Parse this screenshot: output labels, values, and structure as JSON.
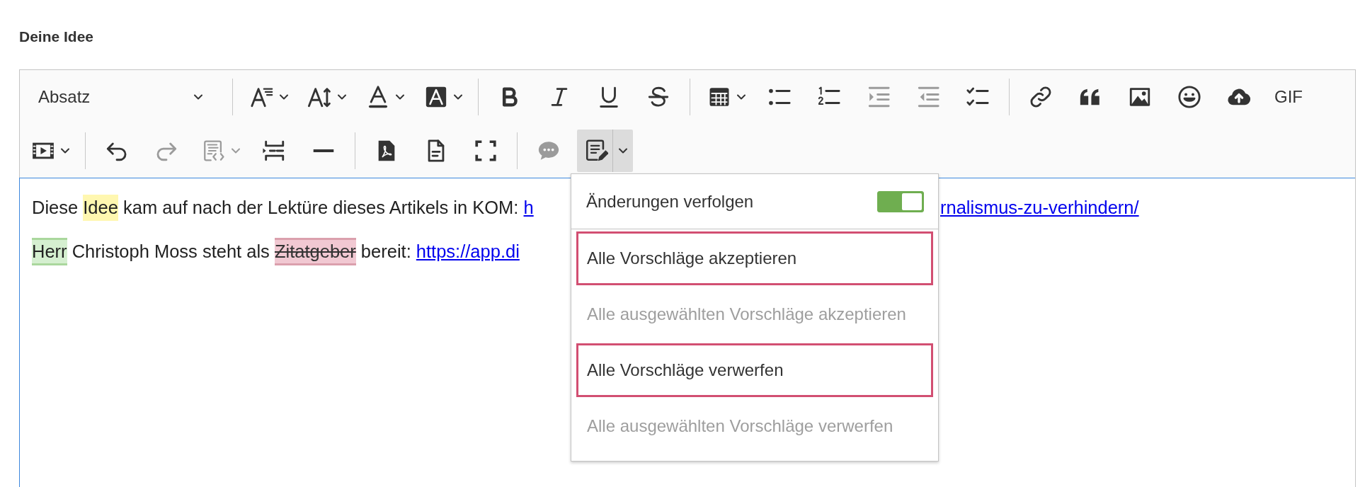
{
  "field_label": "Deine Idee",
  "toolbar": {
    "rows": [
      [
        {
          "kind": "select",
          "value": "Absatz"
        },
        {
          "kind": "separator"
        },
        {
          "kind": "fontsize",
          "disabled": false,
          "pressed": false,
          "dropdown": true
        },
        {
          "kind": "lineheight",
          "disabled": false,
          "pressed": false,
          "dropdown": true
        },
        {
          "kind": "fontcolor",
          "disabled": false,
          "pressed": false,
          "dropdown": true
        },
        {
          "kind": "bgcolor",
          "disabled": false,
          "pressed": false,
          "dropdown": true
        },
        {
          "kind": "separator"
        },
        {
          "kind": "bold",
          "disabled": false,
          "pressed": false,
          "dropdown": false
        },
        {
          "kind": "italic",
          "disabled": false,
          "pressed": false,
          "dropdown": false
        },
        {
          "kind": "underline",
          "disabled": false,
          "pressed": false,
          "dropdown": false
        },
        {
          "kind": "strike",
          "disabled": false,
          "pressed": false,
          "dropdown": false
        },
        {
          "kind": "separator"
        },
        {
          "kind": "table",
          "disabled": false,
          "pressed": false,
          "dropdown": true
        },
        {
          "kind": "bullets",
          "disabled": false,
          "pressed": false,
          "dropdown": false
        },
        {
          "kind": "numbers",
          "disabled": false,
          "pressed": false,
          "dropdown": false
        },
        {
          "kind": "indent",
          "disabled": true,
          "pressed": false,
          "dropdown": false
        },
        {
          "kind": "outdent",
          "disabled": true,
          "pressed": false,
          "dropdown": false
        },
        {
          "kind": "todo",
          "disabled": false,
          "pressed": false,
          "dropdown": false
        },
        {
          "kind": "separator"
        },
        {
          "kind": "link",
          "disabled": false,
          "pressed": false,
          "dropdown": false
        },
        {
          "kind": "quote",
          "disabled": false,
          "pressed": false,
          "dropdown": false
        },
        {
          "kind": "image",
          "disabled": false,
          "pressed": false,
          "dropdown": false
        },
        {
          "kind": "emoji",
          "disabled": false,
          "pressed": false,
          "dropdown": false
        },
        {
          "kind": "upload",
          "disabled": false,
          "pressed": false,
          "dropdown": false
        },
        {
          "kind": "text",
          "label": "GIF",
          "disabled": false,
          "pressed": false,
          "dropdown": false
        }
      ],
      [
        {
          "kind": "video",
          "disabled": false,
          "pressed": false,
          "dropdown": true
        },
        {
          "kind": "separator"
        },
        {
          "kind": "undo",
          "disabled": false,
          "pressed": false,
          "dropdown": false
        },
        {
          "kind": "redo",
          "disabled": true,
          "pressed": false,
          "dropdown": false
        },
        {
          "kind": "source",
          "disabled": true,
          "pressed": false,
          "dropdown": true
        },
        {
          "kind": "pagebreak",
          "disabled": false,
          "pressed": false,
          "dropdown": false
        },
        {
          "kind": "hr",
          "disabled": false,
          "pressed": false,
          "dropdown": false
        },
        {
          "kind": "separator"
        },
        {
          "kind": "pdf",
          "disabled": false,
          "pressed": false,
          "dropdown": false
        },
        {
          "kind": "doc",
          "disabled": false,
          "pressed": false,
          "dropdown": false
        },
        {
          "kind": "fullscreen",
          "disabled": false,
          "pressed": false,
          "dropdown": false
        },
        {
          "kind": "separator"
        },
        {
          "kind": "comment",
          "disabled": true,
          "pressed": false,
          "dropdown": false
        },
        {
          "kind": "track",
          "disabled": false,
          "pressed": true,
          "dropdown": true
        }
      ]
    ]
  },
  "content": {
    "paragraphs": [
      [
        {
          "kind": "plain",
          "text": "Diese "
        },
        {
          "kind": "highlight",
          "text": "Idee"
        },
        {
          "kind": "plain",
          "text": " kam auf nach der Lektüre dieses Artikels in KOM: "
        },
        {
          "kind": "link",
          "text": "h"
        },
        {
          "kind": "link-tail",
          "text": "rnalismus-zu-verhindern/"
        }
      ],
      [
        {
          "kind": "insertion",
          "text": "Herr"
        },
        {
          "kind": "plain",
          "text": " Christoph Moss steht als "
        },
        {
          "kind": "deletion",
          "text": "Zitatgeber"
        },
        {
          "kind": "plain",
          "text": " bereit: "
        },
        {
          "kind": "link",
          "text": "https://app.di"
        }
      ]
    ]
  },
  "menu": {
    "toggle": {
      "label": "Änderungen verfolgen",
      "on": true
    },
    "items": [
      {
        "label": "Alle Vorschläge akzeptieren",
        "disabled": false,
        "outlined": true
      },
      {
        "label": "Alle ausgewählten Vorschläge akzeptieren",
        "disabled": true,
        "outlined": false
      },
      {
        "label": "Alle Vorschläge verwerfen",
        "disabled": false,
        "outlined": true
      },
      {
        "label": "Alle ausgewählten Vorschläge verwerfen",
        "disabled": true,
        "outlined": false
      }
    ]
  }
}
